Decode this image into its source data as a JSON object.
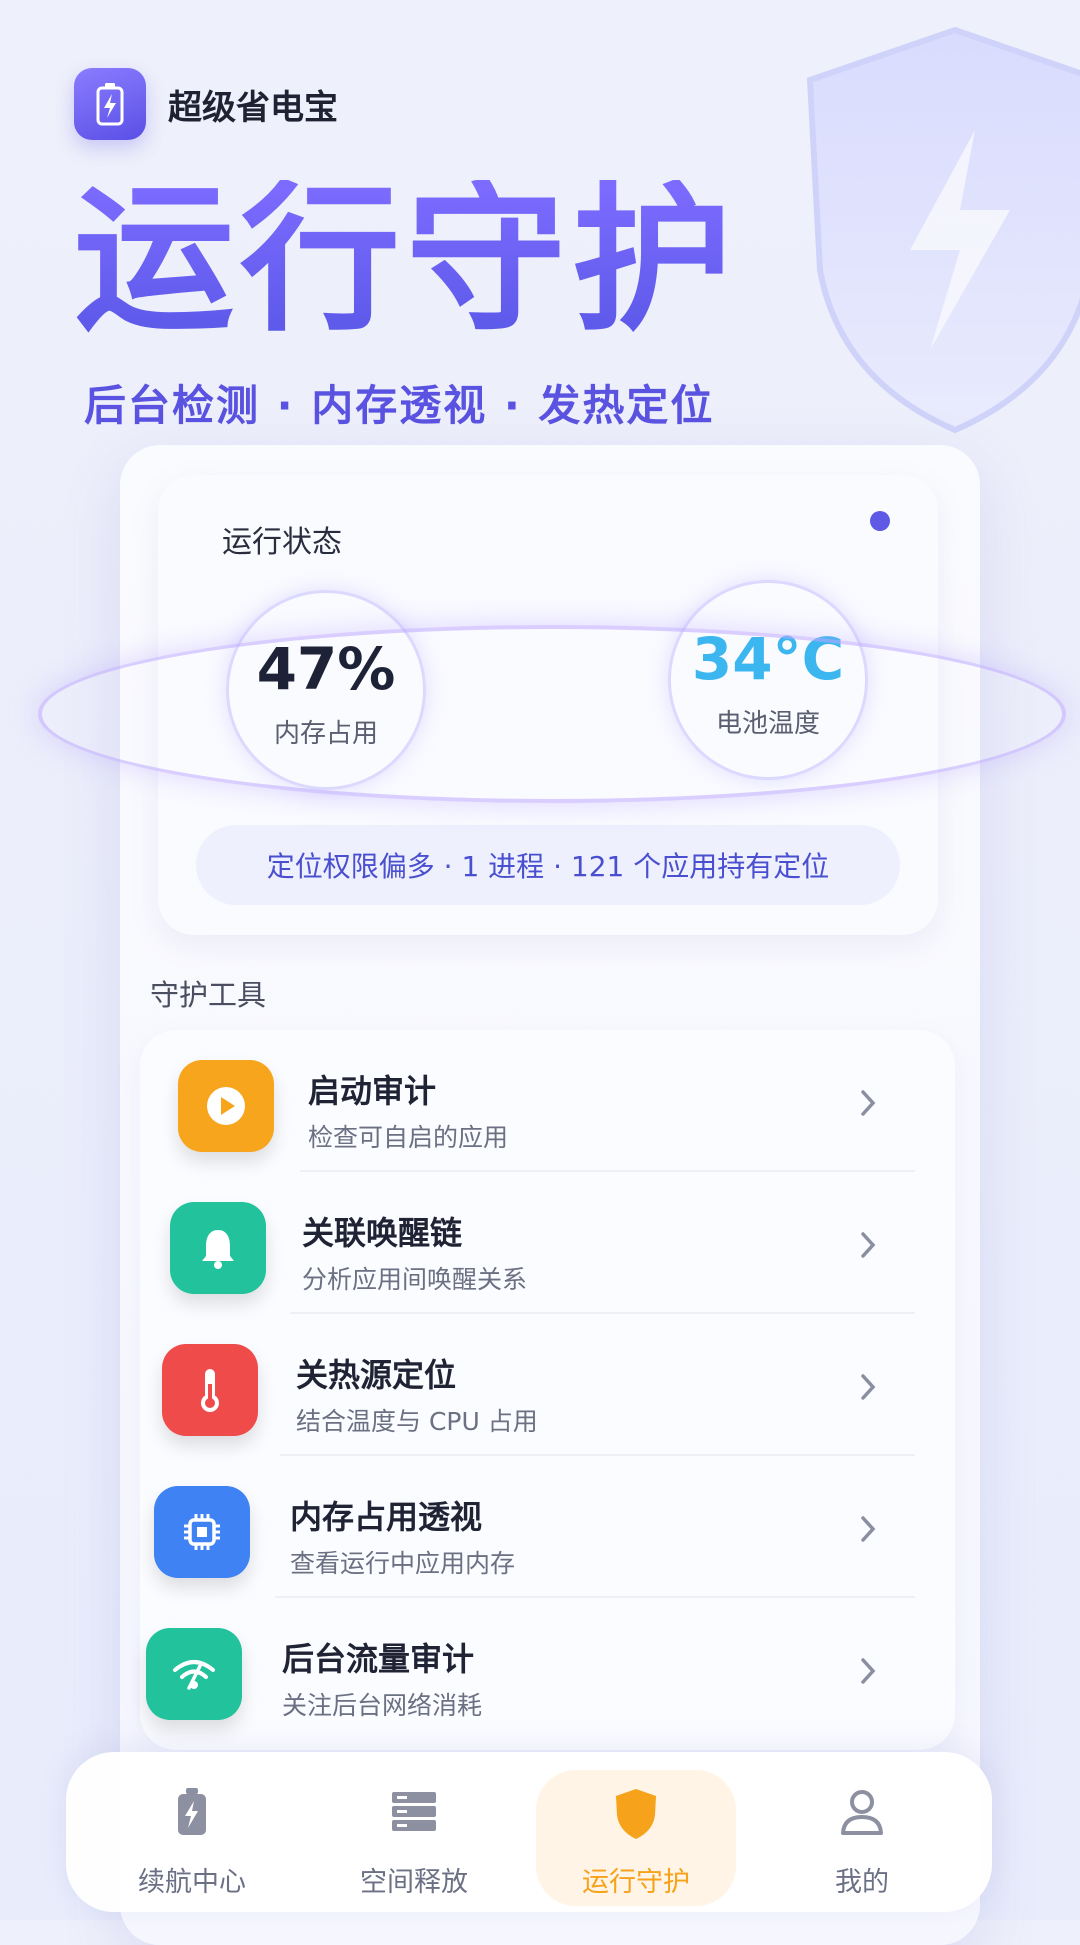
{
  "app": {
    "name": "超级省电宝"
  },
  "hero": {
    "title": "运行守护",
    "subtitle": "后台检测 · 内存透视 · 发热定位"
  },
  "status": {
    "title": "运行状态",
    "memory": {
      "value": "47%",
      "label": "内存占用"
    },
    "temperature": {
      "value": "34°C",
      "label": "电池温度"
    },
    "summary": "定位权限偏多 · 1 进程 · 121 个应用持有定位"
  },
  "tools": {
    "title": "守护工具",
    "items": [
      {
        "title": "启动审计",
        "subtitle": "检查可自启的应用",
        "icon": "play-icon",
        "color": "#f7a51c"
      },
      {
        "title": "关联唤醒链",
        "subtitle": "分析应用间唤醒关系",
        "icon": "bell-icon",
        "color": "#22c39c"
      },
      {
        "title": "关热源定位",
        "subtitle": "结合温度与 CPU 占用",
        "icon": "thermometer-icon",
        "color": "#ef4b4b"
      },
      {
        "title": "内存占用透视",
        "subtitle": "查看运行中应用内存",
        "icon": "chip-icon",
        "color": "#3f82f4"
      },
      {
        "title": "后台流量审计",
        "subtitle": "关注后台网络消耗",
        "icon": "signal-icon",
        "color": "#22c39c"
      }
    ]
  },
  "nav": {
    "items": [
      {
        "label": "续航中心",
        "icon": "battery-icon"
      },
      {
        "label": "空间释放",
        "icon": "storage-icon"
      },
      {
        "label": "运行守护",
        "icon": "shield-icon",
        "active": true
      },
      {
        "label": "我的",
        "icon": "user-icon"
      }
    ]
  },
  "colors": {
    "accent": "#5a52e0",
    "active_nav": "#f6a21a"
  }
}
